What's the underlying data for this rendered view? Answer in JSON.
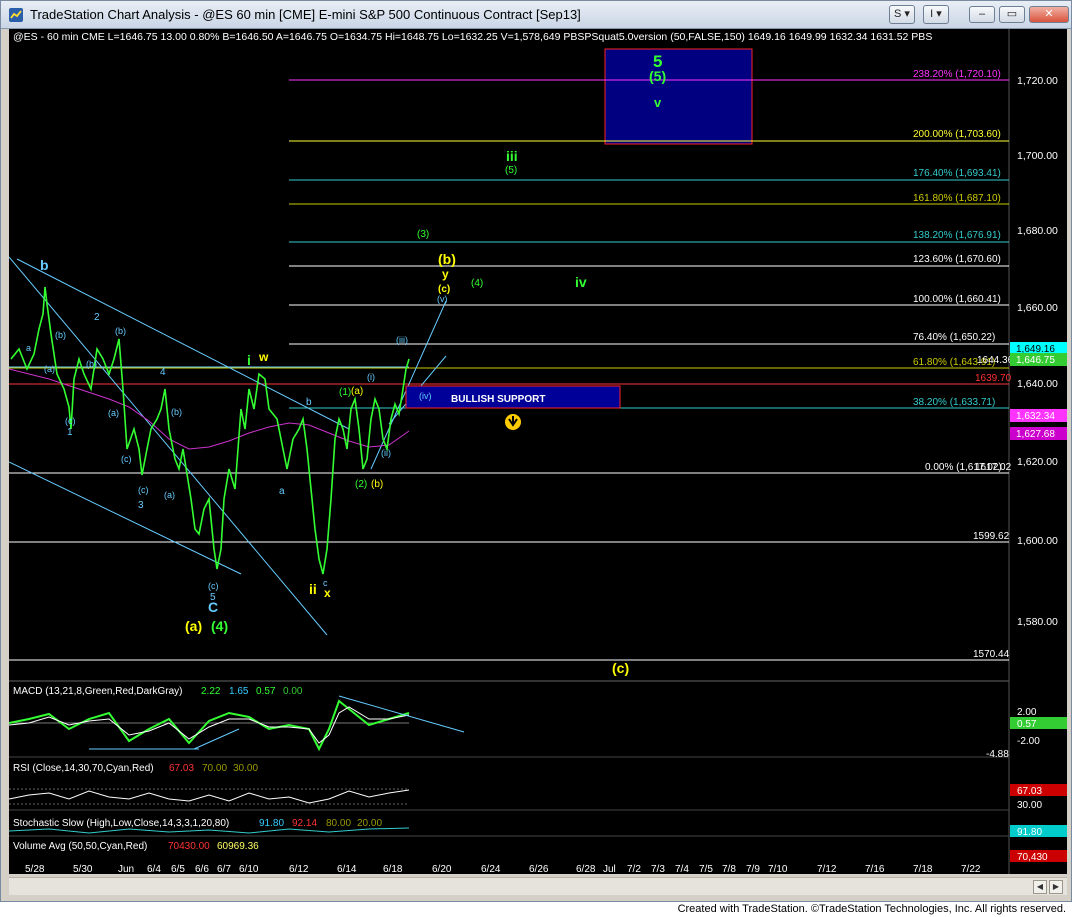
{
  "window": {
    "title": "TradeStation Chart Analysis - @ES 60 min [CME] E-mini S&P 500 Continuous Contract [Sep13]",
    "btn_s": "S ▾",
    "btn_i": "I ▾",
    "min_label": "–",
    "max_label": "▭",
    "close_label": "✕"
  },
  "header": {
    "symbol_line": "@ES - 60 min  CME  L=1646.75  13.00  0.80%   B=1646.50  A=1646.75  O=1634.75  Hi=1648.75  Lo=1632.25  V=1,578,649  PBSPSquat5.0version (50,FALSE,150)   1649.16   1649.99   1632.34   1631.52   PBS"
  },
  "price_axis": [
    "1,720.00",
    "1,700.00",
    "1,680.00",
    "1,660.00",
    "1,640.00",
    "1,620.00",
    "1,600.00",
    "1,580.00"
  ],
  "fib_levels": [
    {
      "label": "238.20% (1,720.10)",
      "color": "#ff33ff"
    },
    {
      "label": "200.00% (1,703.60)",
      "color": "#ffff33"
    },
    {
      "label": "176.40% (1,693.41)",
      "color": "#33cccc"
    },
    {
      "label": "161.80% (1,687.10)",
      "color": "#cccc00"
    },
    {
      "label": "138.20% (1,676.91)",
      "color": "#33cccc"
    },
    {
      "label": "123.60% (1,670.60)",
      "color": "#ffffff"
    },
    {
      "label": "100.00% (1,660.41)",
      "color": "#ffffff"
    },
    {
      "label": "76.40% (1,650.22)",
      "color": "#ffffff"
    },
    {
      "label": "61.80% (1,643.91)",
      "color": "#cccc00"
    },
    {
      "label": "38.20% (1,633.71)",
      "color": "#33cccc"
    },
    {
      "label": "0.00% (1,617.02)",
      "color": "#ffffff"
    }
  ],
  "level_labels": {
    "l1644": "1644.36",
    "l1639": "1639.70",
    "l1617": "1617.02",
    "l1599": "1599.62",
    "l1570": "1570.44"
  },
  "price_tags": {
    "t1": "1,649.16",
    "t2": "1,646.75",
    "t3": "1,632.34",
    "t4": "1,627.68"
  },
  "support_box": "BULLISH SUPPORT",
  "wave_labels": {
    "five": "5",
    "five_paren": "(5)",
    "v": "v",
    "iii": "iii",
    "iii5": "(5)",
    "p3": "(3)",
    "b_big": "(b)",
    "y": "y",
    "c_small": "(c)",
    "v_small": "(v)",
    "p4": "(4)",
    "iv": "iv",
    "iii_small": "(iii)",
    "iv_small": "(iv)",
    "i_small": "(i)",
    "ii_small": "(ii)",
    "one_a": "(1)",
    "a_small": "(a)",
    "two_b": "(2)",
    "b_small": "(b)",
    "b_blue": "b",
    "a_blue": "a",
    "b2": "b",
    "i_green": "i",
    "w": "w",
    "ii_yellow": "ii",
    "x": "x",
    "c_x": "c",
    "C": "C",
    "a_paren": "(a)",
    "four_paren": "(4)",
    "c5": "(c)",
    "five_blue": "5",
    "three": "3",
    "two": "2",
    "four_blue": "4",
    "one": "1",
    "c_paren": "(c)",
    "b_top": "b",
    "b_l": "(b)",
    "a_l": "(a)",
    "c_l": "(c)",
    "a_l2": "(a)",
    "b_l2": "(b)",
    "c_l2": "(c)",
    "a_l3": "(a)",
    "b_l3": "(b)",
    "b_l4": "(b)",
    "a_b": "a",
    "c_big": "(c)"
  },
  "indicators": {
    "macd_title": "MACD (13,21,8,Green,Red,DarkGray)",
    "macd_vals": [
      "2.22",
      "1.65",
      "0.57",
      "0.00"
    ],
    "macd_axis": [
      "2.00",
      "0.57",
      "-2.00",
      "-4.88"
    ],
    "rsi_title": "RSI (Close,14,30,70,Cyan,Red)",
    "rsi_vals": [
      "67.03",
      "70.00",
      "30.00"
    ],
    "rsi_axis": [
      "67.03",
      "30.00"
    ],
    "stoch_title": "Stochastic Slow (High,Low,Close,14,3,3,1,20,80)",
    "stoch_vals": [
      "91.80",
      "92.14",
      "80.00",
      "20.00"
    ],
    "stoch_axis": [
      "91.80"
    ],
    "vol_title": "Volume Avg (50,50,Cyan,Red)",
    "vol_vals": [
      "70430.00",
      "60969.36"
    ],
    "vol_axis": [
      "70,430"
    ]
  },
  "date_axis": [
    "5/28",
    "5/30",
    "Jun",
    "6/4",
    "6/5",
    "6/6",
    "6/7",
    "6/10",
    "6/12",
    "6/14",
    "6/18",
    "6/20",
    "6/24",
    "6/26",
    "6/28",
    "Jul",
    "7/2",
    "7/3",
    "7/4",
    "7/5",
    "7/8",
    "7/9",
    "7/10",
    "7/12",
    "7/16",
    "7/18",
    "7/22"
  ],
  "footer": "Created with TradeStation. ©TradeStation Technologies, Inc. All rights reserved.",
  "colors": {
    "background": "#000000",
    "price_bars": "#33ff33",
    "target_box": "#000080",
    "support_box": "#000099",
    "wave_yellow": "#ffff00",
    "wave_green": "#33ff33",
    "wave_blue": "#66ccff"
  }
}
